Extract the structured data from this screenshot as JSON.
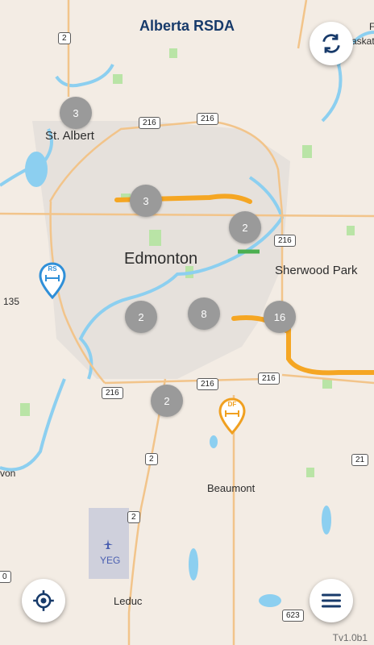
{
  "header": {
    "title": "Alberta RSDA"
  },
  "places": {
    "st_albert": "St. Albert",
    "edmonton": "Edmonton",
    "sherwood_park": "Sherwood Park",
    "beaumont": "Beaumont",
    "leduc": "Leduc",
    "yeg": "YEG",
    "edge_left_1": "135",
    "edge_left_2": "von",
    "edge_top_right_1": "F",
    "edge_top_right_2": "askat"
  },
  "shields": {
    "hwy2_north": "2",
    "hwy216_north": "216",
    "hwy216_north_east": "216",
    "hwy216_east": "216",
    "hwy216_south_west": "216",
    "hwy216_south_mid": "216",
    "hwy216_south_east": "216",
    "hwy2_south": "2",
    "hwy2_leduc": "2",
    "hwy21": "21",
    "hwy623": "623",
    "left_edge_1": "0"
  },
  "clusters": [
    "3",
    "3",
    "2",
    "2",
    "8",
    "16",
    "2"
  ],
  "markers": {
    "rs_label": "RS",
    "df_label": "DF"
  },
  "buttons": {
    "refresh_icon": "refresh-icon",
    "locate_icon": "locate-icon",
    "menu_icon": "menu-icon"
  },
  "footer": {
    "version": "Tv1.0b1"
  },
  "colors": {
    "road_construction": "#f5a623",
    "water": "#8ccff0",
    "park": "#b9e4a6",
    "accent": "#173a6a"
  }
}
